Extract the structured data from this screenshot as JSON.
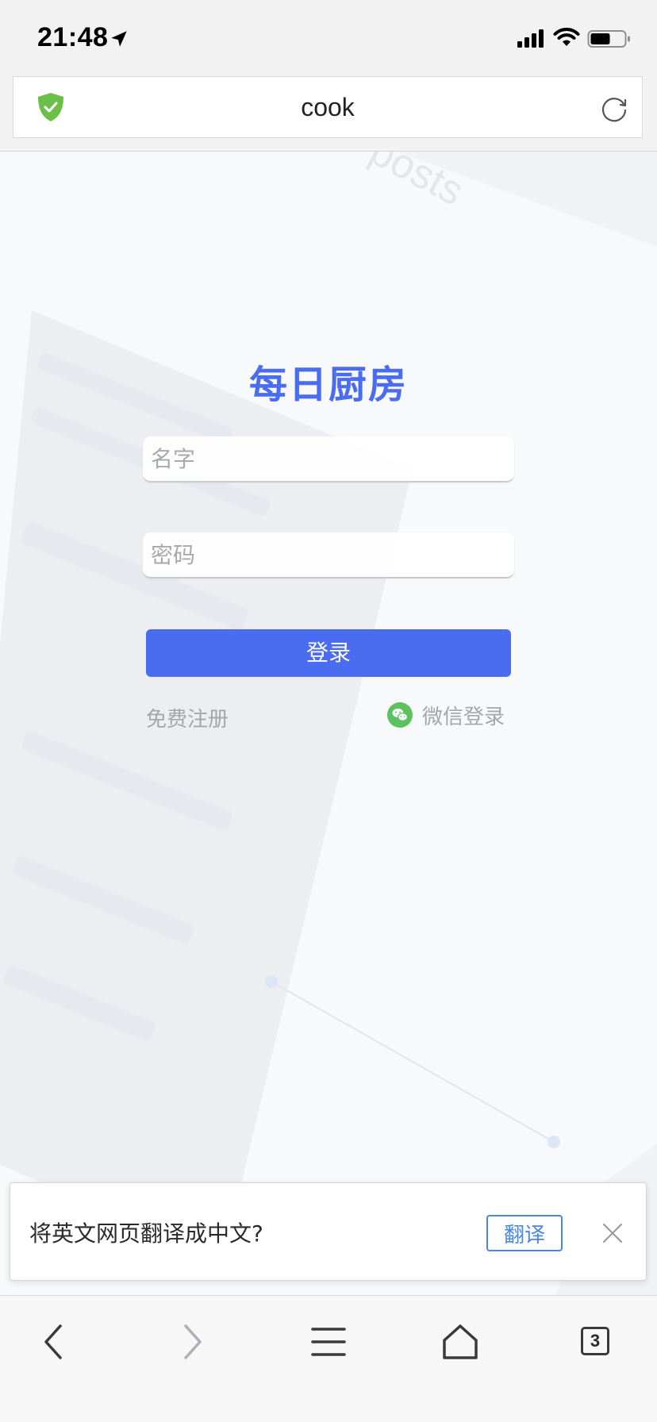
{
  "status_bar": {
    "time": "21:48",
    "icons": [
      "location-arrow-icon",
      "cellular-signal-icon",
      "wifi-icon",
      "battery-icon"
    ]
  },
  "address_bar": {
    "url_text": "cook",
    "icons": [
      "shield-check-icon",
      "reload-icon"
    ],
    "shield_color": "#6cc04a"
  },
  "background": {
    "watermark_text": "posts"
  },
  "login": {
    "title": "每日厨房",
    "name_placeholder": "名字",
    "password_placeholder": "密码",
    "login_button": "登录",
    "register_link": "免费注册",
    "wechat_login": "微信登录",
    "wechat_icon": "wechat-icon",
    "accent_color": "#4a6cf0",
    "wechat_color": "#5bc25d"
  },
  "translate_banner": {
    "prompt": "将英文网页翻译成中文?",
    "translate_button": "翻译",
    "close_icon": "close-icon",
    "button_color": "#4a88e0"
  },
  "toolbar": {
    "items": [
      "back-icon",
      "forward-icon",
      "menu-icon",
      "home-icon",
      "tabs-icon"
    ],
    "tabs_count": "3"
  }
}
